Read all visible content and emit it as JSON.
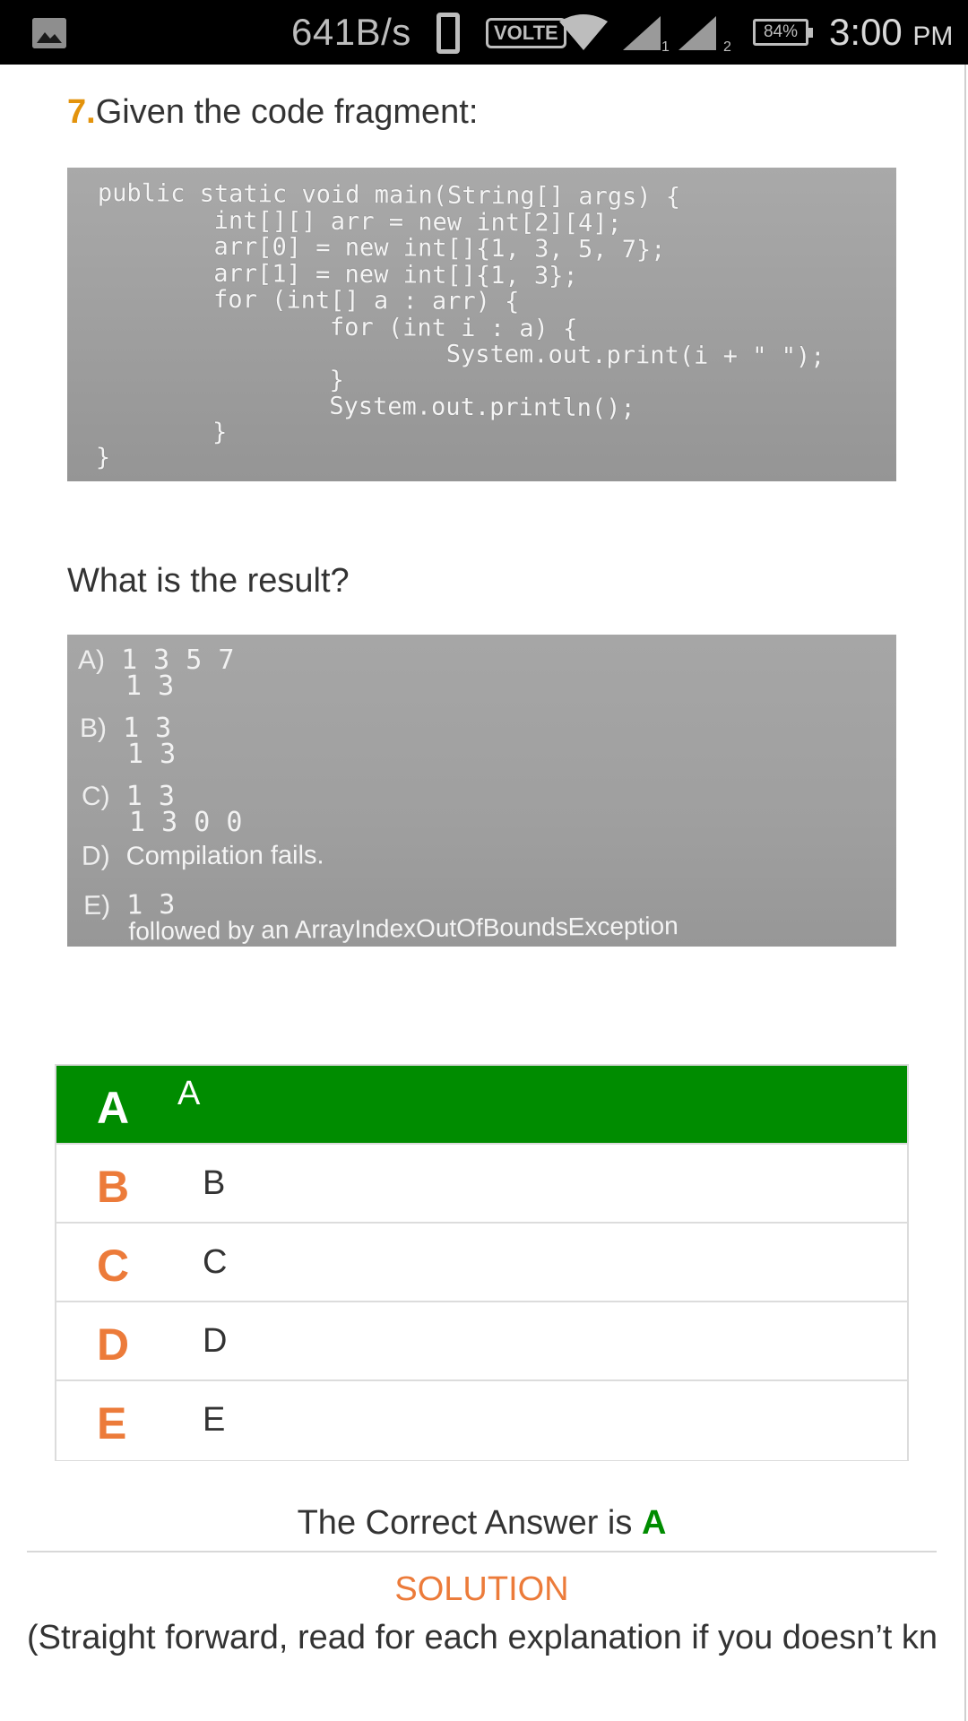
{
  "status_bar": {
    "net_speed": "641B/s",
    "volte": "VOLTE",
    "sim1": "1",
    "sim2": "2",
    "battery": "84%",
    "time": "3:00",
    "ampm": "PM",
    "icons": [
      "gallery-icon",
      "phone-icon",
      "wifi-icon",
      "signal-icon"
    ]
  },
  "question": {
    "number": "7.",
    "title": "Given the code fragment:",
    "code": "public static void main(String[] args) {\n        int[][] arr = new int[2][4];\n        arr[0] = new int[]{1, 3, 5, 7};\n        arr[1] = new int[]{1, 3};\n        for (int[] a : arr) {\n                for (int i : a) {\n                        System.out.print(i + \" \");\n                }\n                System.out.println();\n        }\n}",
    "result_prompt": "What is the result?"
  },
  "image_options": [
    {
      "letter": "A)",
      "line1": "1 3 5 7",
      "line2": "1 3"
    },
    {
      "letter": "B)",
      "line1": "1 3",
      "line2": "1 3"
    },
    {
      "letter": "C)",
      "line1": "1 3",
      "line2": "1 3 0 0"
    },
    {
      "letter": "D)",
      "line1": "Compilation fails.",
      "line2": ""
    },
    {
      "letter": "E)",
      "line1": "1 3",
      "line2": "followed by an ArrayIndexOutOfBoundsException"
    }
  ],
  "choices": [
    {
      "letter": "A",
      "text": "A",
      "selected": true
    },
    {
      "letter": "B",
      "text": "B",
      "selected": false
    },
    {
      "letter": "C",
      "text": "C",
      "selected": false
    },
    {
      "letter": "D",
      "text": "D",
      "selected": false
    },
    {
      "letter": "E",
      "text": "E",
      "selected": false
    }
  ],
  "answer": {
    "prefix": "The Correct Answer is",
    "letter": "A"
  },
  "solution": {
    "heading": "SOLUTION",
    "text": "(Straight forward, read for each explanation if you doesn’t kn"
  },
  "colors": {
    "selected_green": "#008c00",
    "letter_orange": "#ec7b3a",
    "number_orange": "#e3930c"
  }
}
